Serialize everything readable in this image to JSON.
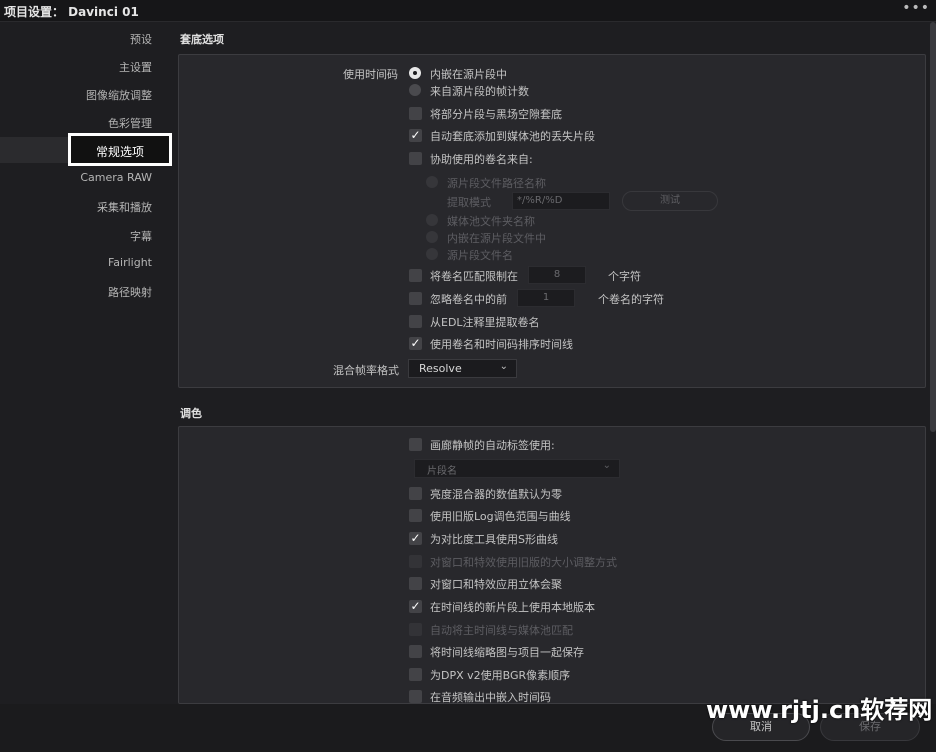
{
  "window": {
    "title": "项目设置：  Davinci 01",
    "menu_glyph": "•••"
  },
  "sidebar": {
    "items": [
      "预设",
      "主设置",
      "图像缩放调整",
      "色彩管理",
      "常规选项",
      "Camera RAW",
      "采集和播放",
      "字幕",
      "Fairlight",
      "路径映射"
    ],
    "active_index": 4
  },
  "conform": {
    "title": "套底选项",
    "timecode_label": "使用时间码",
    "timecode_opt1": "内嵌在源片段中",
    "timecode_opt2": "来自源片段的帧计数",
    "opt_black_gap": "将部分片段与黑场空隙套底",
    "opt_auto_add": "自动套底添加到媒体池的丢失片段",
    "opt_reel_from": "协助使用的卷名来自:",
    "reel_src_path": "源片段文件路径名称",
    "extract_pattern_label": "提取模式",
    "extract_pattern_value": "*/%R/%D",
    "test_button": "测试",
    "reel_media_folder": "媒体池文件夹名称",
    "reel_embedded": "内嵌在源片段文件中",
    "reel_filename": "源片段文件名",
    "limit_label": "将卷名匹配限制在",
    "limit_value": "8",
    "limit_unit": "个字符",
    "ignore_label": "忽略卷名中的前",
    "ignore_value": "1",
    "ignore_unit": "个卷名的字符",
    "edl_label": "从EDL注释里提取卷名",
    "sort_label": "使用卷名和时间码排序时间线",
    "mixed_fps_label": "混合帧率格式",
    "mixed_fps_value": "Resolve"
  },
  "color": {
    "title": "调色",
    "gallery_label": "画廊静帧的自动标签使用:",
    "gallery_select": "片段名",
    "opt1": "亮度混合器的数值默认为零",
    "opt2": "使用旧版Log调色范围与曲线",
    "opt3": "为对比度工具使用S形曲线",
    "opt4": "对窗口和特效使用旧版的大小调整方式",
    "opt5": "对窗口和特效应用立体会聚",
    "opt6": "在时间线的新片段上使用本地版本",
    "opt7": "自动将主时间线与媒体池匹配",
    "opt8": "将时间线缩略图与项目一起保存",
    "opt9": "为DPX v2使用BGR像素顺序",
    "opt10": "在音频输出中嵌入时间码"
  },
  "footer": {
    "cancel": "取消",
    "save": "保存"
  },
  "watermark": "www.rjtj.cn软荐网"
}
